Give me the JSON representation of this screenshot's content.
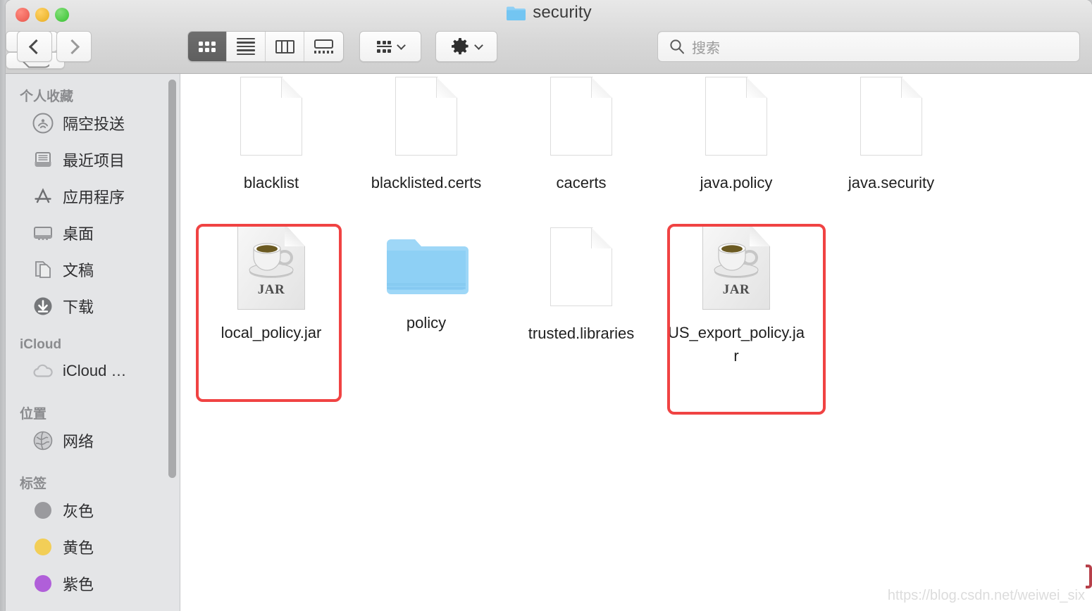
{
  "window": {
    "title": "security",
    "title_icon": "folder-icon",
    "traffic_lights": [
      {
        "name": "close-button",
        "color": "#e8554a"
      },
      {
        "name": "minimize-button",
        "color": "#e8ad1f"
      },
      {
        "name": "maximize-button",
        "color": "#37c130"
      }
    ]
  },
  "toolbar": {
    "back_label": "",
    "forward_label": "",
    "view_modes": [
      {
        "name": "icon-view",
        "icon": "grid-icon",
        "active": true
      },
      {
        "name": "list-view",
        "icon": "list-icon",
        "active": false
      },
      {
        "name": "column-view",
        "icon": "columns-icon",
        "active": false
      },
      {
        "name": "gallery-view",
        "icon": "coverflow-icon",
        "active": false
      }
    ],
    "arrange_icon": "arrange-icon",
    "action_icon": "gear-icon",
    "share_icon": "share-icon",
    "tag_icon": "tag-icon"
  },
  "search": {
    "placeholder": "搜索",
    "value": "",
    "icon": "search-icon"
  },
  "sidebar": {
    "sections": [
      {
        "header": "个人收藏",
        "items": [
          {
            "label": "隔空投送",
            "icon": "airdrop-icon"
          },
          {
            "label": "最近项目",
            "icon": "recents-icon"
          },
          {
            "label": "应用程序",
            "icon": "applications-icon"
          },
          {
            "label": "桌面",
            "icon": "desktop-icon"
          },
          {
            "label": "文稿",
            "icon": "documents-icon"
          },
          {
            "label": "下载",
            "icon": "downloads-icon"
          }
        ]
      },
      {
        "header": "iCloud",
        "items": [
          {
            "label": "iCloud …",
            "icon": "icloud-icon"
          }
        ]
      },
      {
        "header": "位置",
        "items": [
          {
            "label": "网络",
            "icon": "network-icon"
          }
        ]
      },
      {
        "header": "标签",
        "items": [
          {
            "label": "灰色",
            "icon": "tag-dot-icon",
            "color": "#9a9a9e"
          },
          {
            "label": "黄色",
            "icon": "tag-dot-icon",
            "color": "#f2ce57"
          },
          {
            "label": "紫色",
            "icon": "tag-dot-icon",
            "color": "#b05fd9"
          }
        ]
      }
    ]
  },
  "content": {
    "rows": [
      [
        {
          "name": "blacklist",
          "type": "document"
        },
        {
          "name": "blacklisted.certs",
          "type": "document"
        },
        {
          "name": "cacerts",
          "type": "document"
        },
        {
          "name": "java.policy",
          "type": "document"
        },
        {
          "name": "java.security",
          "type": "document"
        }
      ],
      [
        {
          "name": "local_policy.jar",
          "type": "jar",
          "jar_label": "JAR",
          "highlighted": true
        },
        {
          "name": "policy",
          "type": "folder"
        },
        {
          "name": "trusted.libraries",
          "type": "document"
        },
        {
          "name": "US_export_policy.jar",
          "type": "jar",
          "jar_label": "JAR",
          "highlighted": true
        }
      ]
    ]
  },
  "annotations": {
    "highlight_color": "#f04343",
    "watermark": "https://blog.csdn.net/weiwei_six"
  }
}
